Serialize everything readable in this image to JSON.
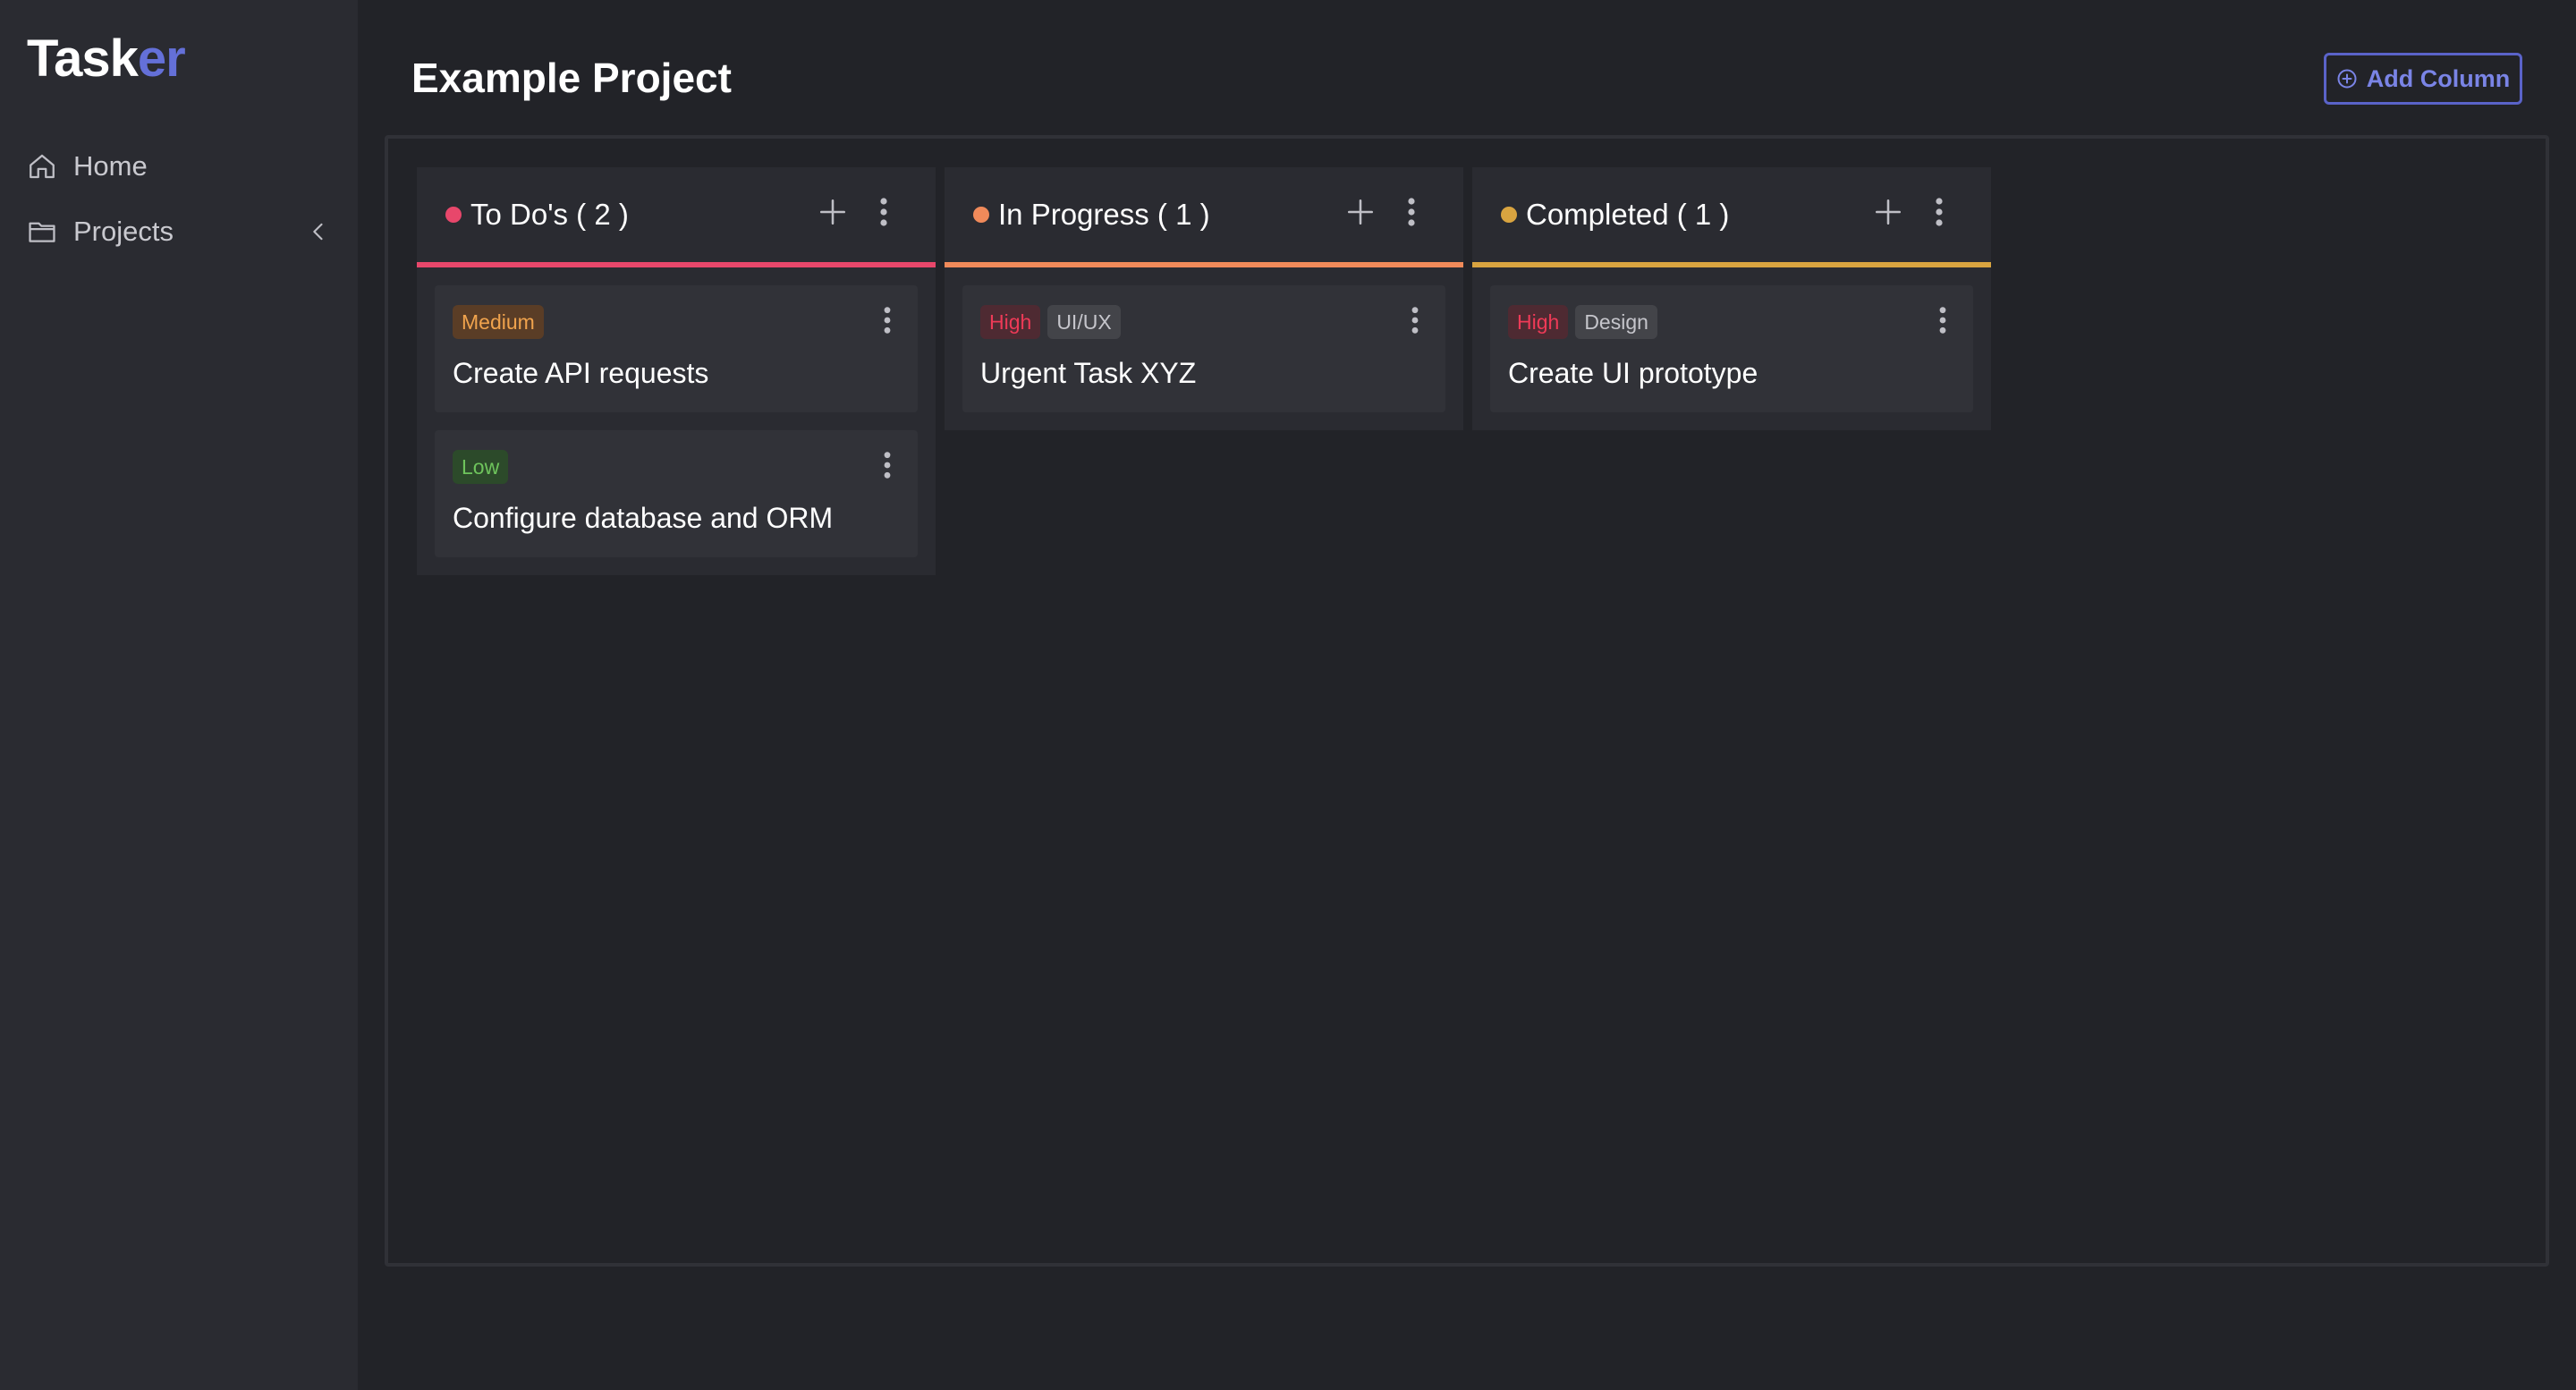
{
  "app": {
    "logo_part1": "Task",
    "logo_part2": "er",
    "accent_color": "#6470d8"
  },
  "sidebar": {
    "items": [
      {
        "label": "Home",
        "icon": "home-icon"
      },
      {
        "label": "Projects",
        "icon": "folder-icon"
      }
    ]
  },
  "header": {
    "title": "Example Project",
    "add_column_label": "Add Column"
  },
  "columns": [
    {
      "title": "To Do's ( 2 )",
      "color": "#e8476b",
      "cards": [
        {
          "tags": [
            {
              "label": "Medium",
              "kind": "medium"
            }
          ],
          "title": "Create API requests"
        },
        {
          "tags": [
            {
              "label": "Low",
              "kind": "low"
            }
          ],
          "title": "Configure database and ORM"
        }
      ]
    },
    {
      "title": "In Progress ( 1 )",
      "color": "#f08a5a",
      "cards": [
        {
          "tags": [
            {
              "label": "High",
              "kind": "high"
            },
            {
              "label": "UI/UX",
              "kind": "neutral"
            }
          ],
          "title": "Urgent Task XYZ"
        }
      ]
    },
    {
      "title": "Completed ( 1 )",
      "color": "#d9a440",
      "cards": [
        {
          "tags": [
            {
              "label": "High",
              "kind": "high"
            },
            {
              "label": "Design",
              "kind": "neutral"
            }
          ],
          "title": "Create UI prototype"
        }
      ]
    }
  ]
}
